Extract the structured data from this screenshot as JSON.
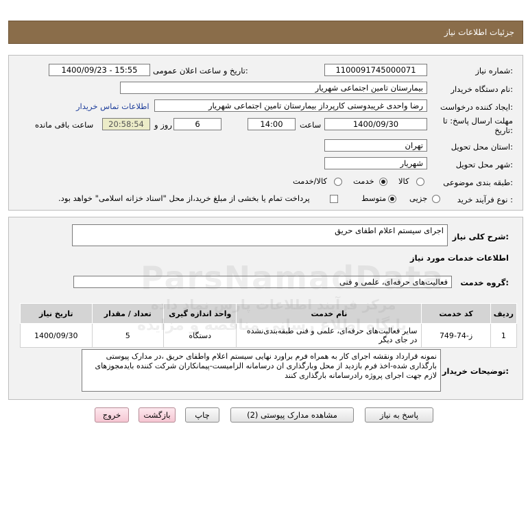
{
  "header": {
    "title": "جزئیات اطلاعات نیاز"
  },
  "form": {
    "need_number_label": "شماره نیاز:",
    "need_number": "1100091745000071",
    "announce_label": "تاریخ و ساعت اعلان عمومی:",
    "announce_value": "1400/09/23 - 15:55",
    "buyer_label": "نام دستگاه خریدار:",
    "buyer_value": "بیمارستان تامین اجتماعی شهریار",
    "creator_label": "ایجاد کننده درخواست:",
    "creator_value": "رضا واحدی غریبدوستی کارپرداز بیمارستان تامین اجتماعی شهریار",
    "contact_link": "اطلاعات تماس خریدار",
    "deadline_label_1": "مهلت ارسال پاسخ: تا",
    "deadline_label_2": "تاریخ:",
    "deadline_date": "1400/09/30",
    "time_label": "ساعت",
    "deadline_time": "14:00",
    "days_value": "6",
    "days_label": "روز و",
    "remaining_value": "20:58:54",
    "remaining_label": "ساعت باقی مانده",
    "province_label": "استان محل تحویل:",
    "province_value": "تهران",
    "city_label": "شهر محل تحویل:",
    "city_value": "شهریار",
    "category_label": "طبقه بندی موضوعی:",
    "category_options": [
      "کالا",
      "خدمت",
      "کالا/خدمت"
    ],
    "category_selected": "خدمت",
    "process_label": "نوع فرآیند خرید :",
    "process_options": [
      "جزیی",
      "متوسط"
    ],
    "process_selected": "متوسط",
    "payment_note": "پرداخت تمام یا بخشی از مبلغ خرید،از محل \"اسناد خزانه اسلامی\" خواهد بود."
  },
  "details": {
    "summary_label": "شرح کلی نیاز:",
    "summary_value": "اجرای سیستم اعلام اطفای حریق",
    "services_heading": "اطلاعات خدمات مورد نیاز",
    "service_group_label": "گروه خدمت:",
    "service_group_value": "فعالیت‌های حرفه‌ای، علمی و فنی",
    "table": {
      "headers": [
        "ردیف",
        "کد خدمت",
        "نام خدمت",
        "واحد اندازه گیری",
        "تعداد / مقدار",
        "تاریخ نیاز"
      ],
      "rows": [
        [
          "1",
          "ز-74-749",
          "سایر فعالیت‌های حرفه‌ای، علمی و فنی طبقه‌بندی‌نشده در جای دیگر",
          "دستگاه",
          "5",
          "1400/09/30"
        ]
      ]
    },
    "buyer_notes_label": "توضیحات خریدار:",
    "buyer_notes_value": "نمونه قرارداد ونقشه اجرای کار به همراه فرم براورد نهایی سیستم اعلام واطفای حریق ،در مدارک پیوستی بارگذاری شده-اخذ فرم بازدید از محل وبارگذاری ان درسامانه الزامیست-پیمانکاران شرکت کننده بایدمجوزهای لازم جهت اجرای پروژه رادرسامانه بارگذاری کنند"
  },
  "buttons": {
    "reply": "پاسخ به نیاز",
    "attachments": "مشاهده مدارک پیوستی (2)",
    "print": "چاپ",
    "back": "بازگشت",
    "exit": "خروج"
  },
  "watermark": {
    "brand": "ParsNamadData",
    "line1": "مرکز فرآیند اطلاعات پارس نماد داده",
    "line2": "پایگاه اطلاع رسانی مناقصه و مزایده"
  }
}
